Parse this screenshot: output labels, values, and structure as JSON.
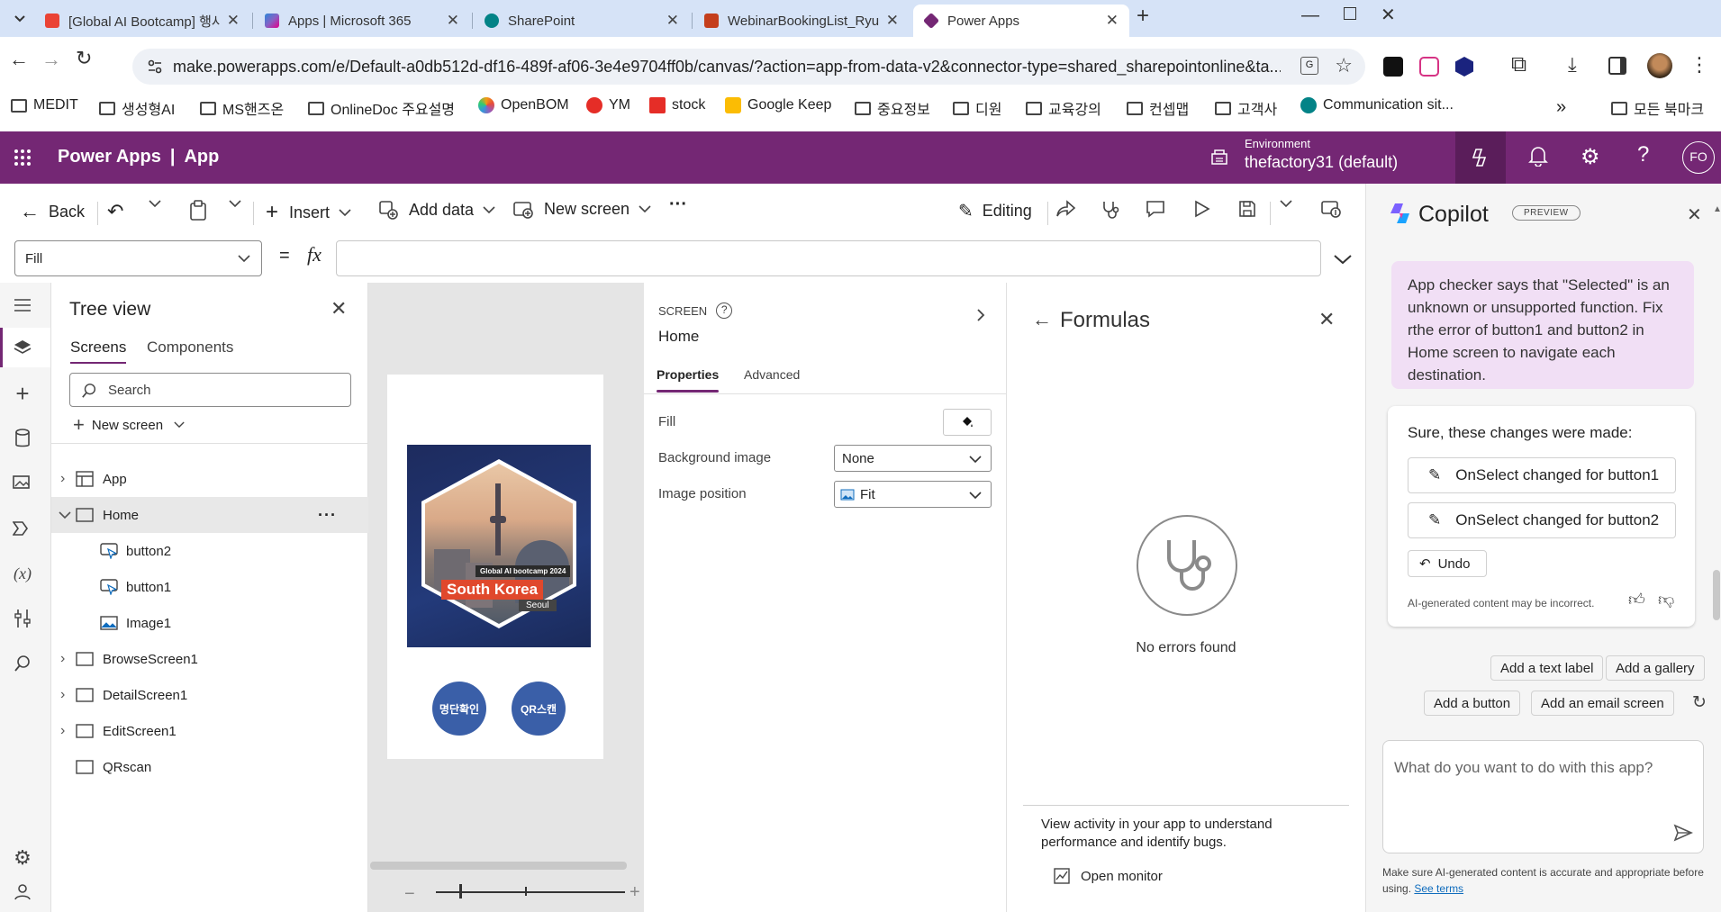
{
  "browser": {
    "tabs": [
      {
        "label": "[Global AI Bootcamp] 행사안내",
        "color": "#ea4335",
        "kind": "gmail"
      },
      {
        "label": "Apps | Microsoft 365",
        "color": "#2b88d8",
        "kind": "m365"
      },
      {
        "label": "SharePoint",
        "color": "#038387",
        "kind": "sp"
      },
      {
        "label": "WebinarBookingList_Ryu",
        "color": "#c43e1c",
        "kind": "list"
      },
      {
        "label": "Power Apps",
        "color": "#742774",
        "kind": "pa"
      }
    ],
    "url": "make.powerapps.com/e/Default-a0db512d-df16-489f-af06-3e4e9704ff0b/canvas/?action=app-from-data-v2&connector-type=shared_sharepointonline&ta...",
    "bookmarks": [
      {
        "label": "MEDIT",
        "type": "folder"
      },
      {
        "label": "생성형AI",
        "type": "folder"
      },
      {
        "label": "MS핸즈온",
        "type": "folder"
      },
      {
        "label": "OnlineDoc 주요설명",
        "type": "folder"
      },
      {
        "label": "OpenBOM",
        "type": "site",
        "color": "#f39c12"
      },
      {
        "label": "YM",
        "type": "site",
        "color": "#e52d27"
      },
      {
        "label": "stock",
        "type": "site",
        "color": "#e52d27"
      },
      {
        "label": "Google Keep",
        "type": "site",
        "color": "#fbbc04"
      },
      {
        "label": "중요정보",
        "type": "folder"
      },
      {
        "label": "디원",
        "type": "folder"
      },
      {
        "label": "교육강의",
        "type": "folder"
      },
      {
        "label": "컨셉맵",
        "type": "folder"
      },
      {
        "label": "고객사",
        "type": "folder"
      },
      {
        "label": "Communication sit...",
        "type": "site",
        "color": "#038387"
      }
    ],
    "bookmarks_overflow": "»",
    "all_bookmarks": "모든 북마크"
  },
  "header": {
    "brand": "Power Apps",
    "separator": "|",
    "app": "App",
    "env_label": "Environment",
    "env_name": "thefactory31 (default)",
    "avatar": "FO"
  },
  "toolbar": {
    "back": "Back",
    "insert": "Insert",
    "add_data": "Add data",
    "new_screen": "New screen",
    "more": "···",
    "editing": "Editing"
  },
  "formula": {
    "property": "Fill",
    "equals": "=",
    "fx": "fx",
    "value": ""
  },
  "tree": {
    "title": "Tree view",
    "tabs": [
      "Screens",
      "Components"
    ],
    "search_placeholder": "Search",
    "new_screen": "New screen",
    "items": [
      {
        "label": "App",
        "level": 0,
        "expand": "›",
        "icon": "app"
      },
      {
        "label": "Home",
        "level": 0,
        "expand": "⌄",
        "icon": "screen",
        "selected": true
      },
      {
        "label": "button2",
        "level": 1,
        "icon": "button"
      },
      {
        "label": "button1",
        "level": 1,
        "icon": "button"
      },
      {
        "label": "Image1",
        "level": 1,
        "icon": "image"
      },
      {
        "label": "BrowseScreen1",
        "level": 0,
        "expand": "›",
        "icon": "screen"
      },
      {
        "label": "DetailScreen1",
        "level": 0,
        "expand": "›",
        "icon": "screen"
      },
      {
        "label": "EditScreen1",
        "level": 0,
        "expand": "›",
        "icon": "screen"
      },
      {
        "label": "QRscan",
        "level": 0,
        "icon": "screen"
      }
    ]
  },
  "canvas": {
    "badge": {
      "line1": "Global AI bootcamp 2024",
      "line2": "South Korea",
      "line3": "Seoul"
    },
    "buttons": [
      "명단확인",
      "QR스캔"
    ]
  },
  "props": {
    "type": "SCREEN",
    "name": "Home",
    "tabs": [
      "Properties",
      "Advanced"
    ],
    "fill": "Fill",
    "bg_image": "Background image",
    "bg_image_value": "None",
    "image_position": "Image position",
    "image_position_value": "Fit"
  },
  "formulas": {
    "title": "Formulas",
    "empty": "No errors found",
    "monitor_text": "View activity in your app to understand performance and identify bugs.",
    "open_monitor": "Open monitor"
  },
  "copilot": {
    "title": "Copilot",
    "badge": "PREVIEW",
    "user_msg": "App checker says that \"Selected\" is an unknown or unsupported function. Fix rthe error of button1 and button2 in Home screen to navigate each destination.",
    "reply": "Sure, these changes were made:",
    "changes": [
      "OnSelect changed for button1",
      "OnSelect changed for button2"
    ],
    "undo": "Undo",
    "disclaimer": "AI-generated content may be incorrect.",
    "suggestions": [
      "Add a text label",
      "Add a gallery",
      "Add a button",
      "Add an email screen"
    ],
    "input_placeholder": "What do you want to do with this app?",
    "footer": "Make sure AI-generated content is accurate and appropriate before using.",
    "terms": "See terms"
  },
  "colors": {
    "brand": "#742774",
    "accent": "#0f6cbd",
    "canvas_button": "#3a5fa8"
  }
}
